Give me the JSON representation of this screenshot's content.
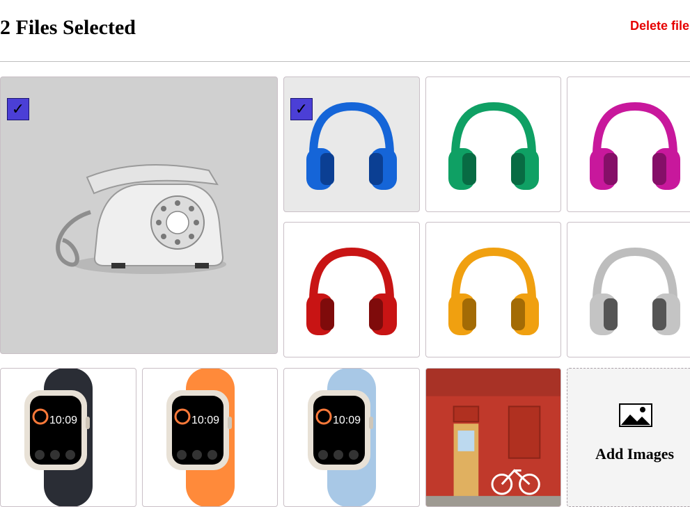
{
  "header": {
    "title": "2 Files Selected",
    "delete_label": "Delete file"
  },
  "gallery": {
    "items": [
      {
        "name": "telephone",
        "selected": true
      },
      {
        "name": "headphones",
        "color": "#1565d8",
        "selected": true
      },
      {
        "name": "headphones",
        "color": "#0fa064",
        "selected": false
      },
      {
        "name": "headphones",
        "color": "#c8189c",
        "selected": false
      },
      {
        "name": "headphones",
        "color": "#c81414",
        "selected": false
      },
      {
        "name": "headphones",
        "color": "#f0a010",
        "selected": false
      },
      {
        "name": "headphones",
        "color": "#b0b0b0",
        "selected": false
      },
      {
        "name": "smartwatch",
        "color": "#2a2d35",
        "time": "10:09",
        "selected": false
      },
      {
        "name": "smartwatch",
        "color": "#ff8a3a",
        "time": "10:09",
        "selected": false
      },
      {
        "name": "smartwatch",
        "color": "#a8c8e6",
        "time": "10:09",
        "selected": false
      },
      {
        "name": "red-brick-building",
        "selected": false
      }
    ],
    "add_label": "Add Images",
    "checkmark": "✓"
  },
  "colors": {
    "delete": "#e60000",
    "checkbox": "#4b3fd6"
  }
}
